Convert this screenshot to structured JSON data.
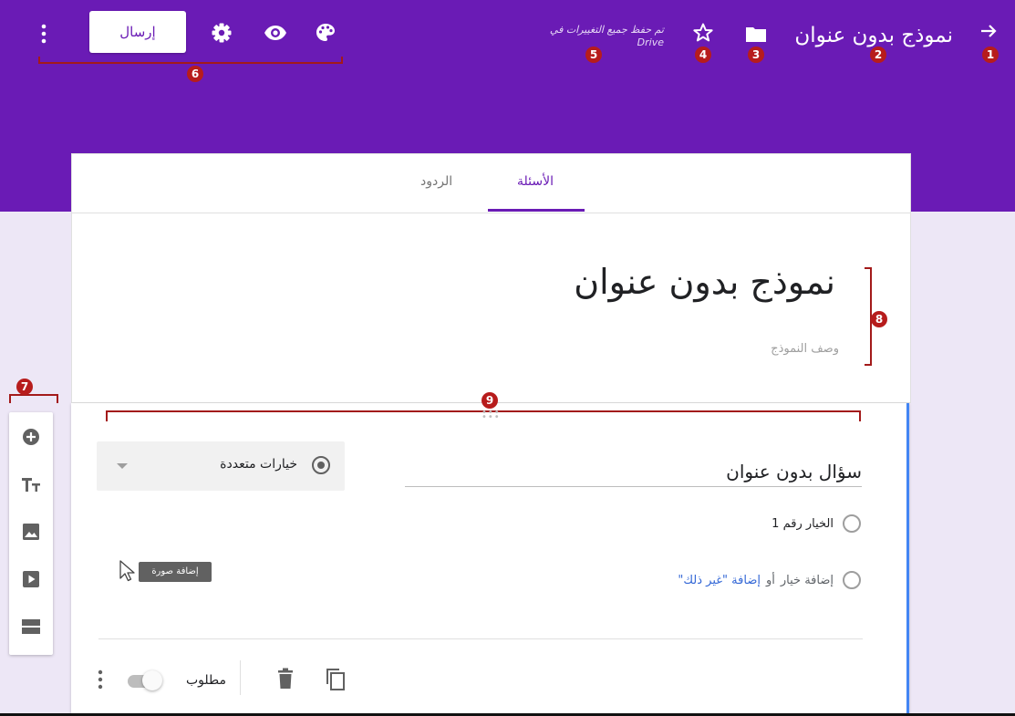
{
  "header": {
    "form_title": "نموذج بدون عنوان",
    "saved_line1": "تم حفظ جميع التغييرات في",
    "saved_line2": "Drive",
    "send_label": "إرسال"
  },
  "tabs": {
    "questions": "الأسئلة",
    "responses": "الردود"
  },
  "form": {
    "title": "نموذج بدون عنوان",
    "description_placeholder": "وصف النموذج"
  },
  "question": {
    "title": "سؤال بدون عنوان",
    "type": "خيارات متعددة",
    "option1": "الخيار رقم 1",
    "add_option": "إضافة خيار",
    "or": "أو",
    "add_other": "إضافة \"غير ذلك\"",
    "tooltip": "إضافة صورة",
    "required_label": "مطلوب",
    "required": false
  },
  "annotations": [
    "1",
    "2",
    "3",
    "4",
    "5",
    "6",
    "7",
    "8",
    "9"
  ],
  "colors": {
    "header_bg": "#6a1bb5",
    "accent": "#6a1bb5",
    "page_bg": "#ede7f6",
    "annotation": "#b71c1c",
    "focus_bar": "#4285f4"
  },
  "icons": {
    "back": "arrow-right-icon",
    "folder": "folder-icon",
    "star": "star-icon",
    "palette": "palette-icon",
    "preview": "eye-icon",
    "settings": "gear-icon",
    "more": "more-vert-icon",
    "add": "add-circle-icon",
    "title": "text-title-icon",
    "image": "image-icon",
    "video": "video-icon",
    "section": "section-icon",
    "duplicate": "copy-icon",
    "delete": "trash-icon"
  }
}
